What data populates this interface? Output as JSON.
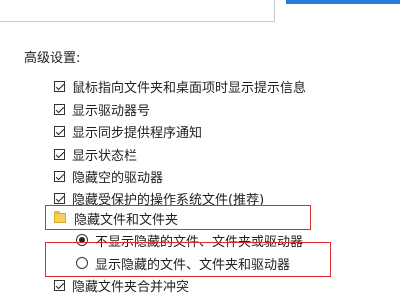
{
  "settings": {
    "heading": "高级设置:",
    "items": [
      {
        "type": "checkbox",
        "checked": true,
        "label": "鼠标指向文件夹和桌面项时显示提示信息"
      },
      {
        "type": "checkbox",
        "checked": true,
        "label": "显示驱动器号"
      },
      {
        "type": "checkbox",
        "checked": true,
        "label": "显示同步提供程序通知"
      },
      {
        "type": "checkbox",
        "checked": true,
        "label": "显示状态栏"
      },
      {
        "type": "checkbox",
        "checked": true,
        "label": "隐藏空的驱动器"
      },
      {
        "type": "checkbox",
        "checked": true,
        "label": "隐藏受保护的操作系统文件(推荐)"
      },
      {
        "type": "folder",
        "label": "隐藏文件和文件夹"
      },
      {
        "type": "radio",
        "selected": true,
        "label": "不显示隐藏的文件、文件夹或驱动器"
      },
      {
        "type": "radio",
        "selected": false,
        "label": "显示隐藏的文件、文件夹和驱动器"
      },
      {
        "type": "checkbox",
        "checked": true,
        "label": "隐藏文件夹合并冲突"
      }
    ]
  },
  "colors": {
    "highlight_border": "#e0292f",
    "accent": "#2b79d6"
  }
}
